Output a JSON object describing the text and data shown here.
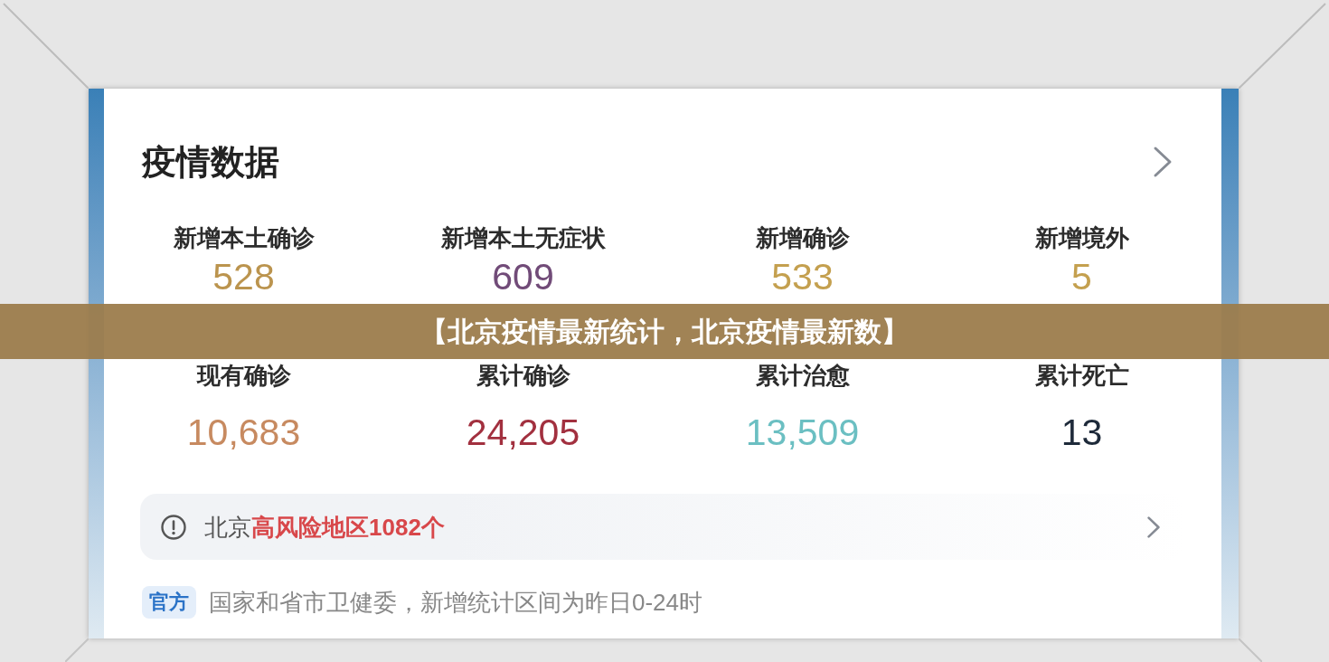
{
  "card": {
    "title": "疫情数据"
  },
  "stats": [
    {
      "label": "新增本土确诊",
      "value": "528",
      "color": "#bb944e"
    },
    {
      "label": "新增本土无症状",
      "value": "609",
      "color": "#714b78"
    },
    {
      "label": "新增确诊",
      "value": "533",
      "color": "#c4a04f"
    },
    {
      "label": "新增境外",
      "value": "5",
      "color": "#c4a04f"
    },
    {
      "label": "现有确诊",
      "value": "10,683",
      "color": "#c78a60"
    },
    {
      "label": "累计确诊",
      "value": "24,205",
      "color": "#a2303f"
    },
    {
      "label": "累计治愈",
      "value": "13,509",
      "color": "#6bbfc2"
    },
    {
      "label": "累计死亡",
      "value": "13",
      "color": "#1e2a3a"
    }
  ],
  "overlay_banner": {
    "text": "【北京疫情最新统计，北京疫情最新数】"
  },
  "alert": {
    "text": "北京**高风险地区1082个**"
  },
  "footer": {
    "badge": "官方",
    "note": "国家和省市卫健委，新增统计区间为昨日0-24时"
  }
}
